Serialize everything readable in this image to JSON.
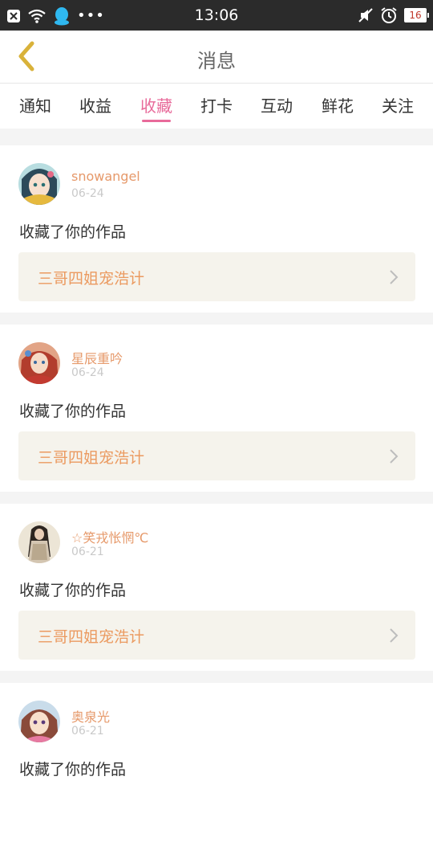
{
  "status_bar": {
    "time": "13:06",
    "battery": "16",
    "icons": [
      "close-notification-icon",
      "wifi-icon",
      "qq-penguin-icon",
      "more-dots-icon",
      "mute-icon",
      "alarm-icon",
      "battery-icon"
    ]
  },
  "header": {
    "title": "消息",
    "back_icon": "chevron-left-icon"
  },
  "tabs": [
    {
      "label": "通知"
    },
    {
      "label": "收益"
    },
    {
      "label": "收藏",
      "active": true
    },
    {
      "label": "打卡"
    },
    {
      "label": "互动"
    },
    {
      "label": "鲜花"
    },
    {
      "label": "关注"
    }
  ],
  "messages": [
    {
      "user": "snowangel",
      "date": "06-24",
      "text": "收藏了你的作品",
      "work": "三哥四姐宠浩计"
    },
    {
      "user": "星辰重吟",
      "date": "06-24",
      "text": "收藏了你的作品",
      "work": "三哥四姐宠浩计"
    },
    {
      "user": "☆笑戎怅惘℃",
      "date": "06-21",
      "text": "收藏了你的作品",
      "work": "三哥四姐宠浩计"
    },
    {
      "user": "奥泉光",
      "date": "06-21",
      "text": "收藏了你的作品",
      "work": ""
    }
  ],
  "colors": {
    "accent_pink": "#e86a9a",
    "username_orange": "#e6996a",
    "work_orange": "#eb9a60",
    "back_yellow": "#d9b23a"
  }
}
